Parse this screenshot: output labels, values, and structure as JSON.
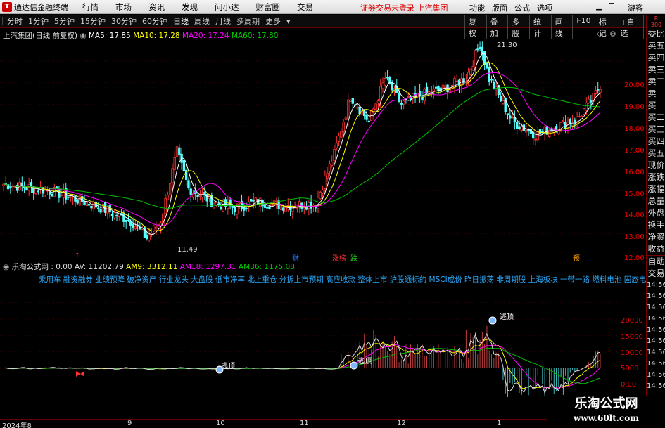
{
  "app": {
    "title": "通达信金融终端",
    "logo": "T",
    "menu": [
      "行情",
      "市场",
      "资讯",
      "发现",
      "问小达",
      "财富圈",
      "交易"
    ],
    "login_status": "证券交易未登录  上汽集团",
    "right_menu": [
      "功能",
      "版面",
      "公式",
      "选项"
    ],
    "guest": "游客"
  },
  "periods": [
    {
      "label": "分时",
      "active": false
    },
    {
      "label": "1分钟",
      "active": false
    },
    {
      "label": "5分钟",
      "active": false
    },
    {
      "label": "15分钟",
      "active": false
    },
    {
      "label": "30分钟",
      "active": false
    },
    {
      "label": "60分钟",
      "active": false
    },
    {
      "label": "日线",
      "active": true
    },
    {
      "label": "周线",
      "active": false
    },
    {
      "label": "月线",
      "active": false
    },
    {
      "label": "多周期",
      "active": false
    },
    {
      "label": "更多",
      "active": false
    }
  ],
  "toolbar": [
    "复权",
    "叠加",
    "多股",
    "统计",
    "画线",
    "F10",
    "标记",
    "+自选",
    "返回"
  ],
  "main_chart": {
    "stock": "上汽集团(日线 前复权)",
    "ma5": "MA5: 17.85",
    "ma10": "MA10: 17.28",
    "ma20": "MA20: 17.24",
    "ma60": "MA60: 17.80",
    "high_label": "21.30",
    "low_label": "11.49",
    "price_ticks": [
      "20.00",
      "19.00",
      "18.00",
      "17.00",
      "16.00",
      "15.00",
      "14.00",
      "13.00",
      "12.00"
    ]
  },
  "indicator": {
    "name": "乐淘公式网 : 0.00",
    "av": "AV: 11202.79",
    "am9": "AM9: 3312.11",
    "am18": "AM18: 1297.31",
    "am36": "AM36: 1175.08",
    "ticks": [
      "20000",
      "15000",
      "10000",
      "5000",
      "0.00"
    ],
    "signal": "逃顶"
  },
  "ticker": "乘用车 融资融券 业绩预降 破净资产 行业龙头 大盘股 低市净率 北上重仓 分拆上市预期 高应收款 整体上市 沪股通标的 MSCI成份 昨日振荡 非周期股 上海板块 一带一路 燃料电池 固态电池 氢能",
  "markers": {
    "cai": "财",
    "zhangting": "涨榜",
    "die": "跌",
    "yu": "预"
  },
  "x_axis": [
    "2024年8",
    "9",
    "10",
    "11",
    "12",
    "1"
  ],
  "right_panel": [
    "R",
    "300",
    "委比",
    "卖五",
    "卖四",
    "卖三",
    "卖二",
    "卖一",
    "买一",
    "买二",
    "买三",
    "买四",
    "买五",
    "现价",
    "涨跌",
    "涨幅",
    "总量",
    "外盘",
    "换手",
    "净资",
    "收益",
    "自动",
    "交易",
    "14:56",
    "14:56",
    "14:56",
    "14:56",
    "14:56",
    "14:56",
    "14:56",
    "14:56",
    "14:56",
    "14:56"
  ],
  "watermark": {
    "title": "乐淘公式网",
    "url": "www.60lt.com"
  },
  "colors": {
    "up": "#ff3232",
    "down": "#54ffff",
    "ma5": "#ffffff",
    "ma10": "#ffff00",
    "ma20": "#ff00ff",
    "ma60": "#00c000"
  }
}
